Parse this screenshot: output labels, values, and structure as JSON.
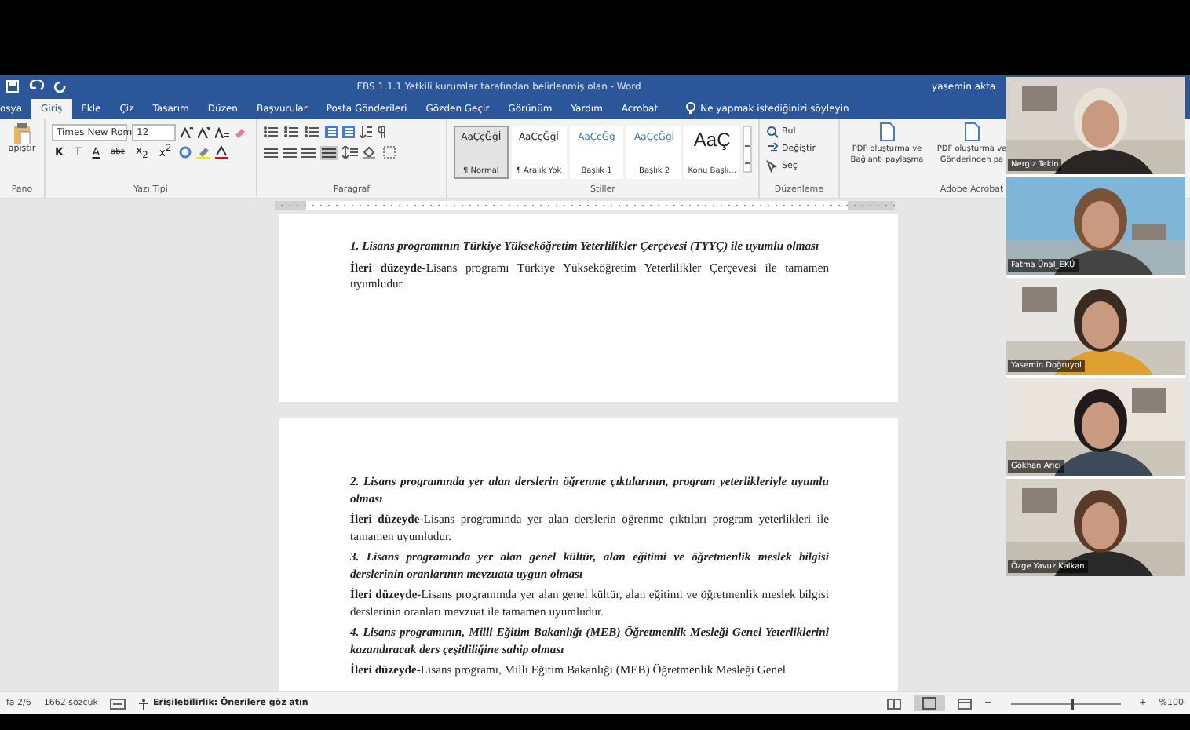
{
  "window": {
    "title": "EBS 1.1.1 Yetkili kurumlar tarafından belirlenmiş olan  -  Word",
    "user": "yasemin akta"
  },
  "tabs": [
    {
      "label": "osya",
      "selected": false
    },
    {
      "label": "Giriş",
      "selected": true
    },
    {
      "label": "Ekle",
      "selected": false
    },
    {
      "label": "Çiz",
      "selected": false
    },
    {
      "label": "Tasarım",
      "selected": false
    },
    {
      "label": "Düzen",
      "selected": false
    },
    {
      "label": "Başvurular",
      "selected": false
    },
    {
      "label": "Posta Gönderileri",
      "selected": false
    },
    {
      "label": "Gözden Geçir",
      "selected": false
    },
    {
      "label": "Görünüm",
      "selected": false
    },
    {
      "label": "Yardım",
      "selected": false
    },
    {
      "label": "Acrobat",
      "selected": false
    }
  ],
  "tell_me": {
    "placeholder": "Ne yapmak istediğinizi söyleyin"
  },
  "ribbon": {
    "paste_label": "apıştır",
    "font": "Times New Rom",
    "size": "12",
    "format_buttons": [
      "K",
      "T",
      "A",
      "abc",
      "x$_{2}$",
      "x$^{2}$"
    ],
    "styles": [
      {
        "sample": "AaÇçĞğİ",
        "name": "¶ Normal",
        "selected": true
      },
      {
        "sample": "AaÇçĞğİ",
        "name": "¶ Aralık Yok",
        "selected": false
      },
      {
        "sample": "AaÇçĞğ",
        "name": "Başlık 1",
        "selected": false
      },
      {
        "sample": "AaÇçĞğİ",
        "name": "Başlık 2",
        "selected": false
      },
      {
        "sample": "AaÇ",
        "name": "Konu Başlı...",
        "selected": false
      }
    ],
    "editing": [
      "Bul",
      "Değiştir",
      "Seç"
    ],
    "acrobat": [
      "PDF oluşturma ve Bağlantı paylaşma",
      "PDF oluşturma ve Gönderinden pa"
    ],
    "groups": [
      "Pano",
      "Yazı Tipi",
      "Paragraf",
      "Stiller",
      "Düzenleme",
      "Adobe Acrobat"
    ]
  },
  "pages": [
    {
      "blocks": [
        {
          "kind": "heading",
          "text": "1. Lisans programının Türkiye Yükseköğretim Yeterlilikler Çerçevesi (TYYÇ) ile uyumlu olması"
        },
        {
          "kind": "body",
          "text": "**İleri düzeyde-**Lisans programı Türkiye Yükseköğretim Yeterlilikler Çerçevesi ile tamamen uyumludur."
        }
      ]
    },
    {
      "blocks": [
        {
          "kind": "heading",
          "text": "2. Lisans programında yer alan derslerin öğrenme çıktılarının, program yeterlikleriyle uyumlu olması"
        },
        {
          "kind": "body",
          "text": "**İleri düzeyde-**Lisans programında yer alan derslerin öğrenme çıktıları program yeterlikleri ile tamamen uyumludur."
        },
        {
          "kind": "heading",
          "text": "3. Lisans programında yer alan genel kültür, alan eğitimi ve öğretmenlik meslek bilgisi derslerinin oranlarının mevzuata uygun olması"
        },
        {
          "kind": "body",
          "text": "**İleri düzeyde-**Lisans programında yer alan genel kültür, alan eğitimi ve öğretmenlik meslek bilgisi derslerinin oranları mevzuat ile tamamen uyumludur."
        },
        {
          "kind": "heading",
          "text": "4. Lisans programının, Milli Eğitim Bakanlığı (MEB) Öğretmenlik Mesleği Genel Yeterliklerini kazandıracak ders çeşitliliğine sahip olması"
        },
        {
          "kind": "body",
          "text": "**İleri düzeyde-**Lisans programı, Milli Eğitim Bakanlığı (MEB) Öğretmenlik Mesleği Genel"
        }
      ]
    }
  ],
  "status_bar": {
    "page": "fa 2/6",
    "words": "1662 sözcük",
    "accessibility": "Erişilebilirlik: Önerilere göz atın",
    "zoom_out": "−",
    "zoom_in": "+",
    "zoom": "%100",
    "zoom_level": {
      "level": 0.55
    }
  },
  "participants": [
    {
      "name": "Nergiz Tekin"
    },
    {
      "name": "Fatma Ünal_EKÜ"
    },
    {
      "name": "Yasemin Doğruyol"
    },
    {
      "name": "Gökhan Arıcı"
    },
    {
      "name": "Özge Yavuz Kalkan"
    }
  ]
}
